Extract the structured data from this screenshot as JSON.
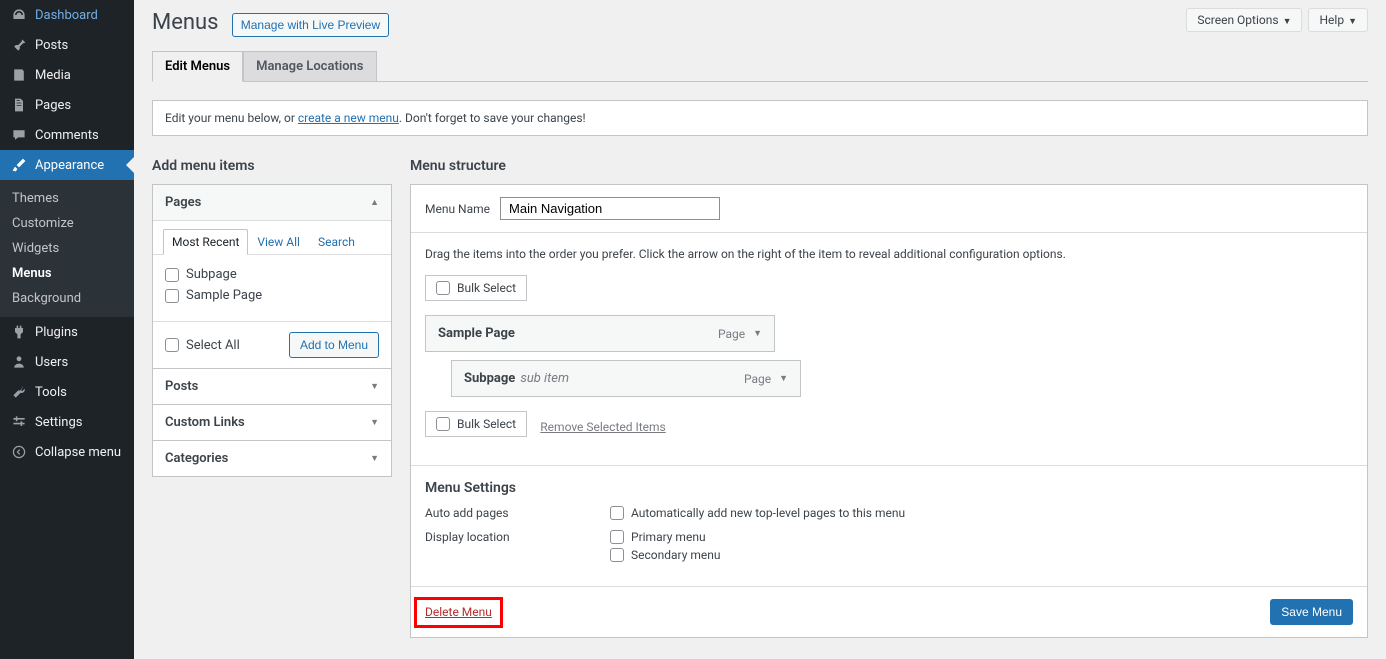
{
  "screen_options": "Screen Options",
  "help": "Help",
  "sidebar": {
    "items": [
      {
        "label": "Dashboard"
      },
      {
        "label": "Posts"
      },
      {
        "label": "Media"
      },
      {
        "label": "Pages"
      },
      {
        "label": "Comments"
      },
      {
        "label": "Appearance"
      },
      {
        "label": "Plugins"
      },
      {
        "label": "Users"
      },
      {
        "label": "Tools"
      },
      {
        "label": "Settings"
      },
      {
        "label": "Collapse menu"
      }
    ],
    "sub": [
      {
        "label": "Themes"
      },
      {
        "label": "Customize"
      },
      {
        "label": "Widgets"
      },
      {
        "label": "Menus"
      },
      {
        "label": "Background"
      }
    ]
  },
  "page_title": "Menus",
  "live_preview": "Manage with Live Preview",
  "tabs": {
    "edit": "Edit Menus",
    "locations": "Manage Locations"
  },
  "notice": {
    "pre": "Edit your menu below, or ",
    "link": "create a new menu",
    "post": ". Don't forget to save your changes!"
  },
  "left": {
    "heading": "Add menu items",
    "pages": "Pages",
    "inner_tabs": {
      "recent": "Most Recent",
      "view_all": "View All",
      "search": "Search"
    },
    "items": [
      "Subpage",
      "Sample Page"
    ],
    "select_all": "Select All",
    "add_to_menu": "Add to Menu",
    "posts": "Posts",
    "custom_links": "Custom Links",
    "categories": "Categories"
  },
  "right": {
    "heading": "Menu structure",
    "name_label": "Menu Name",
    "name_value": "Main Navigation",
    "hint": "Drag the items into the order you prefer. Click the arrow on the right of the item to reveal additional configuration options.",
    "bulk_select": "Bulk Select",
    "remove_selected": "Remove Selected Items",
    "menu_items": [
      {
        "title": "Sample Page",
        "type": "Page",
        "sub": ""
      },
      {
        "title": "Subpage",
        "type": "Page",
        "sub": "sub item"
      }
    ],
    "settings_heading": "Menu Settings",
    "auto_add": "Auto add pages",
    "auto_add_opt": "Automatically add new top-level pages to this menu",
    "display_loc": "Display location",
    "loc_primary": "Primary menu",
    "loc_secondary": "Secondary menu",
    "delete": "Delete Menu",
    "save": "Save Menu"
  }
}
